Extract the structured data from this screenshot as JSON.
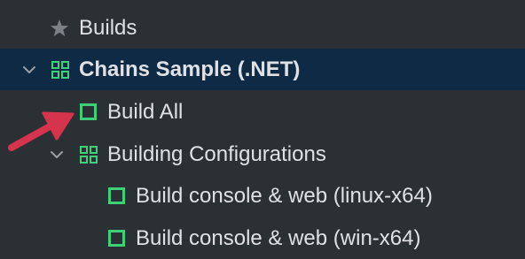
{
  "tree": {
    "items": [
      {
        "label": "Builds",
        "icon": "star-icon",
        "level": 0,
        "expanded": null,
        "selected": false
      },
      {
        "label": "Chains Sample (.NET)",
        "icon": "grid-icon",
        "level": 0,
        "expanded": true,
        "selected": true
      },
      {
        "label": "Build All",
        "icon": "build-config-icon",
        "level": 1,
        "expanded": null,
        "selected": false
      },
      {
        "label": "Building Configurations",
        "icon": "grid-icon",
        "level": 1,
        "expanded": true,
        "selected": false
      },
      {
        "label": "Build console & web (linux-x64)",
        "icon": "build-config-icon",
        "level": 2,
        "expanded": null,
        "selected": false
      },
      {
        "label": "Build console & web (win-x64)",
        "icon": "build-config-icon",
        "level": 2,
        "expanded": null,
        "selected": false
      }
    ]
  },
  "colors": {
    "background": "#2b3035",
    "selected_row": "#0e2a45",
    "text": "#dfe1e5",
    "icon_green": "#3fd07a",
    "star_gray": "#7c8187",
    "chevron_gray": "#9aa0a6",
    "annotation_arrow": "#d6334d"
  }
}
